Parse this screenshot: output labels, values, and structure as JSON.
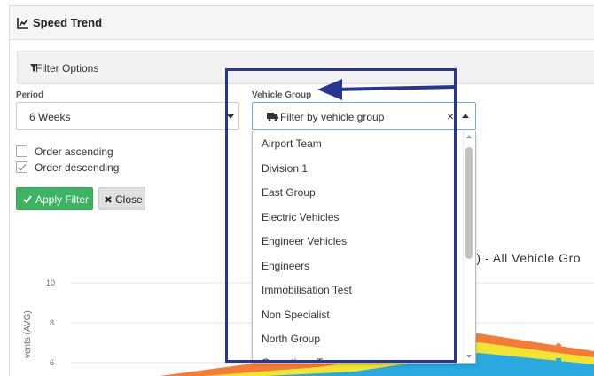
{
  "panel": {
    "title": "Speed Trend",
    "title_icon": "line-chart-icon"
  },
  "filter_bar": {
    "label": "Filter Options",
    "icon": "filter-icon"
  },
  "period": {
    "label": "Period",
    "value": "6 Weeks"
  },
  "vehicle_group": {
    "label": "Vehicle Group",
    "placeholder": "Filter by vehicle group",
    "icon": "truck-icon",
    "clear_glyph": "×",
    "options": [
      "Airport Team",
      "Division 1",
      "East Group",
      "Electric Vehicles",
      "Engineer Vehicles",
      "Engineers",
      "Immobilisation Test",
      "Non Specialist",
      "North Group",
      "Operations Team"
    ]
  },
  "order": {
    "ascending_label": "Order ascending",
    "ascending_checked": false,
    "descending_label": "Order descending",
    "descending_checked": true
  },
  "buttons": {
    "apply_label": "Apply Filter",
    "close_label": "Close"
  },
  "chart_data": {
    "type": "area",
    "title": "G) - All Vehicle Gro",
    "ylabel": "vents (AVG)",
    "yticks": [
      "10",
      "8",
      "6"
    ],
    "ylim": [
      5,
      10
    ],
    "series": [
      {
        "color": "#29a9e0"
      },
      {
        "color": "#f2e532"
      },
      {
        "color": "#f57c38"
      }
    ]
  },
  "colors": {
    "accent": "#283593",
    "apply_button": "#3cb463",
    "close_button": "#e0e0e0"
  }
}
